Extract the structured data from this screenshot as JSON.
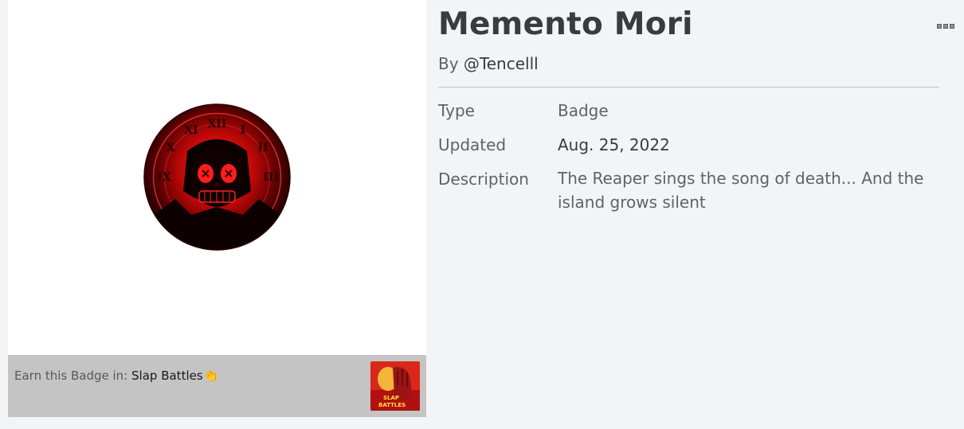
{
  "badge": {
    "title": "Memento Mori",
    "by_label": "By",
    "creator": "@Tencelll",
    "image_icon": "grim-reaper-skull-clock-badge"
  },
  "details": {
    "type_label": "Type",
    "type_value": "Badge",
    "updated_label": "Updated",
    "updated_value": "Aug. 25, 2022",
    "description_label": "Description",
    "description_value": "The Reaper sings the song of death... And the island grows silent"
  },
  "earn": {
    "prefix": "Earn this Badge in:",
    "game_name": "Slap Battles",
    "game_emoji": "👏",
    "game_thumb_text": "SLAP BATTLES"
  },
  "more_menu": {
    "icon": "more-options-icon"
  },
  "colors": {
    "page_background": "#f2f4f5",
    "badge_red": "#e01818",
    "earn_bar": "#c4c4c4"
  }
}
